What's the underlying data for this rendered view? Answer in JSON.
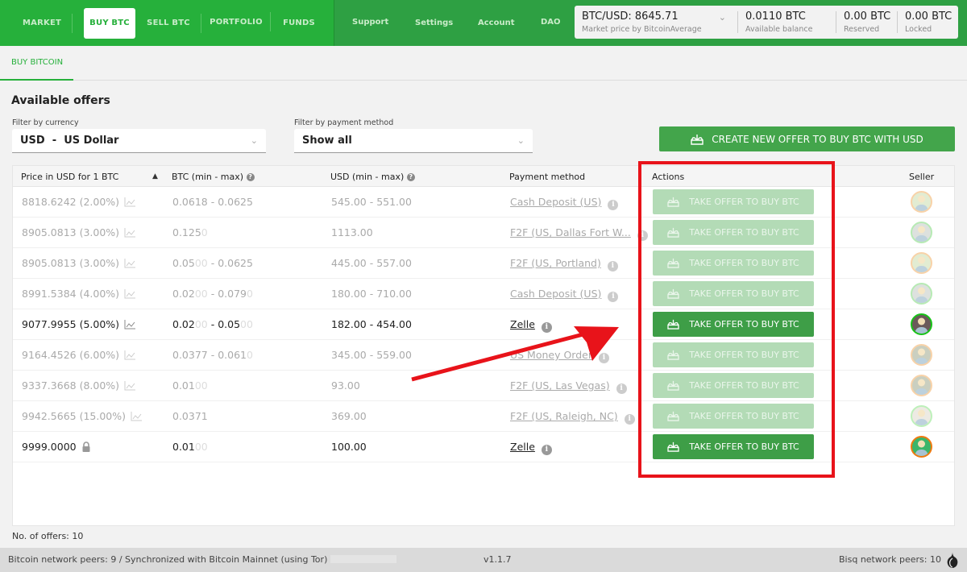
{
  "nav": {
    "primary": [
      {
        "label": "MARKET",
        "active": false
      },
      {
        "label": "BUY BTC",
        "active": true
      },
      {
        "label": "SELL BTC",
        "active": false
      },
      {
        "label": "PORTFOLIO",
        "active": false
      },
      {
        "label": "FUNDS",
        "active": false
      }
    ],
    "secondary": [
      {
        "label": "Support"
      },
      {
        "label": "Settings"
      },
      {
        "label": "Account"
      },
      {
        "label": "DAO"
      }
    ]
  },
  "balances": {
    "price": {
      "value": "BTC/USD: 8645.71",
      "label": "Market price by BitcoinAverage"
    },
    "available": {
      "value": "0.0110 BTC",
      "label": "Available balance"
    },
    "reserved": {
      "value": "0.00 BTC",
      "label": "Reserved"
    },
    "locked": {
      "value": "0.00 BTC",
      "label": "Locked"
    }
  },
  "subtab": {
    "label": "BUY BITCOIN"
  },
  "page": {
    "title": "Available offers"
  },
  "filters": {
    "currency": {
      "label": "Filter by currency",
      "value": "USD  -  US Dollar"
    },
    "payment": {
      "label": "Filter by payment method",
      "value": "Show all"
    }
  },
  "create_button": {
    "label": "CREATE NEW OFFER TO BUY BTC WITH USD"
  },
  "table": {
    "headers": {
      "price": "Price in USD for 1 BTC",
      "btc": "BTC (min - max)",
      "usd": "USD (min - max)",
      "payment": "Payment method",
      "actions": "Actions",
      "seller": "Seller"
    },
    "sort_indicator": "▲",
    "rows": [
      {
        "price": "8818.6242 (2.00%)",
        "price_icon": "chart",
        "btc_main": "0.0618 - 0.0625",
        "btc_pad": "",
        "btc_main2": "",
        "btc_pad2": "",
        "usd": "545.00 - 551.00",
        "payment": "Cash Deposit (US)",
        "action": "TAKE OFFER TO BUY BTC",
        "enabled": false,
        "avatar_ring": "#f6c48c",
        "avatar_bg": "#d9e6c4"
      },
      {
        "price": "8905.0813 (3.00%)",
        "price_icon": "chart",
        "btc_main": "0.125",
        "btc_pad": "0",
        "btc_main2": "",
        "btc_pad2": "",
        "usd": "1113.00",
        "payment": "F2F (US, Dallas Fort W...",
        "action": "TAKE OFFER TO BUY BTC",
        "enabled": false,
        "avatar_ring": "#9fe49c",
        "avatar_bg": "#d2d7d4"
      },
      {
        "price": "8905.0813 (3.00%)",
        "price_icon": "chart",
        "btc_main": "0.05",
        "btc_pad": "00",
        "btc_main2": " - 0.0625",
        "btc_pad2": "",
        "usd": "445.00 - 557.00",
        "payment": "F2F (US, Portland)",
        "action": "TAKE OFFER TO BUY BTC",
        "enabled": false,
        "avatar_ring": "#f6c48c",
        "avatar_bg": "#d9e6c4"
      },
      {
        "price": "8991.5384 (4.00%)",
        "price_icon": "chart",
        "btc_main": "0.02",
        "btc_pad": "00",
        "btc_main2": " - 0.079",
        "btc_pad2": "0",
        "usd": "180.00 - 710.00",
        "payment": "Cash Deposit (US)",
        "action": "TAKE OFFER TO BUY BTC",
        "enabled": false,
        "avatar_ring": "#9fe49c",
        "avatar_bg": "#d2d7d4"
      },
      {
        "price": "9077.9955 (5.00%)",
        "price_icon": "chart",
        "btc_main": "0.02",
        "btc_pad": "00",
        "btc_main2": " - 0.05",
        "btc_pad2": "00",
        "usd": "182.00 - 454.00",
        "payment": "Zelle",
        "action": "TAKE OFFER TO BUY BTC",
        "enabled": true,
        "avatar_ring": "#18c418",
        "avatar_bg": "#6b5a5a"
      },
      {
        "price": "9164.4526 (6.00%)",
        "price_icon": "chart",
        "btc_main": "0.0377 - 0.061",
        "btc_pad": "0",
        "btc_main2": "",
        "btc_pad2": "",
        "usd": "345.00 - 559.00",
        "payment": "US Money Order",
        "action": "TAKE OFFER TO BUY BTC",
        "enabled": false,
        "avatar_ring": "#f6c48c",
        "avatar_bg": "#b9c0ac"
      },
      {
        "price": "9337.3668 (8.00%)",
        "price_icon": "chart",
        "btc_main": "0.01",
        "btc_pad": "00",
        "btc_main2": "",
        "btc_pad2": "",
        "usd": "93.00",
        "payment": "F2F (US, Las Vegas)",
        "action": "TAKE OFFER TO BUY BTC",
        "enabled": false,
        "avatar_ring": "#f6c48c",
        "avatar_bg": "#b9c0ac"
      },
      {
        "price": "9942.5665 (15.00%)",
        "price_icon": "chart",
        "btc_main": "0.0371",
        "btc_pad": "",
        "btc_main2": "",
        "btc_pad2": "",
        "usd": "369.00",
        "payment": "F2F (US, Raleigh, NC)",
        "action": "TAKE OFFER TO BUY BTC",
        "enabled": false,
        "avatar_ring": "#a8eca4",
        "avatar_bg": "#e8e3da"
      },
      {
        "price": "9999.0000",
        "price_icon": "lock",
        "btc_main": "0.01",
        "btc_pad": "00",
        "btc_main2": "",
        "btc_pad2": "",
        "usd": "100.00",
        "payment": "Zelle",
        "action": "TAKE OFFER TO BUY BTC",
        "enabled": true,
        "avatar_ring": "#f07a10",
        "avatar_bg": "#3cb56a"
      }
    ]
  },
  "offer_count": "No. of offers: 10",
  "status": {
    "bitcoin": "Bitcoin network peers: 9 / Synchronized with Bitcoin Mainnet (using Tor)",
    "version": "v1.1.7",
    "bisq": "Bisq network peers: 10"
  },
  "colors": {
    "brand_green": "#26b03b",
    "button_green": "#3e9e47",
    "button_disabled": "#b3dbb6",
    "annotation_red": "#e8131a"
  }
}
